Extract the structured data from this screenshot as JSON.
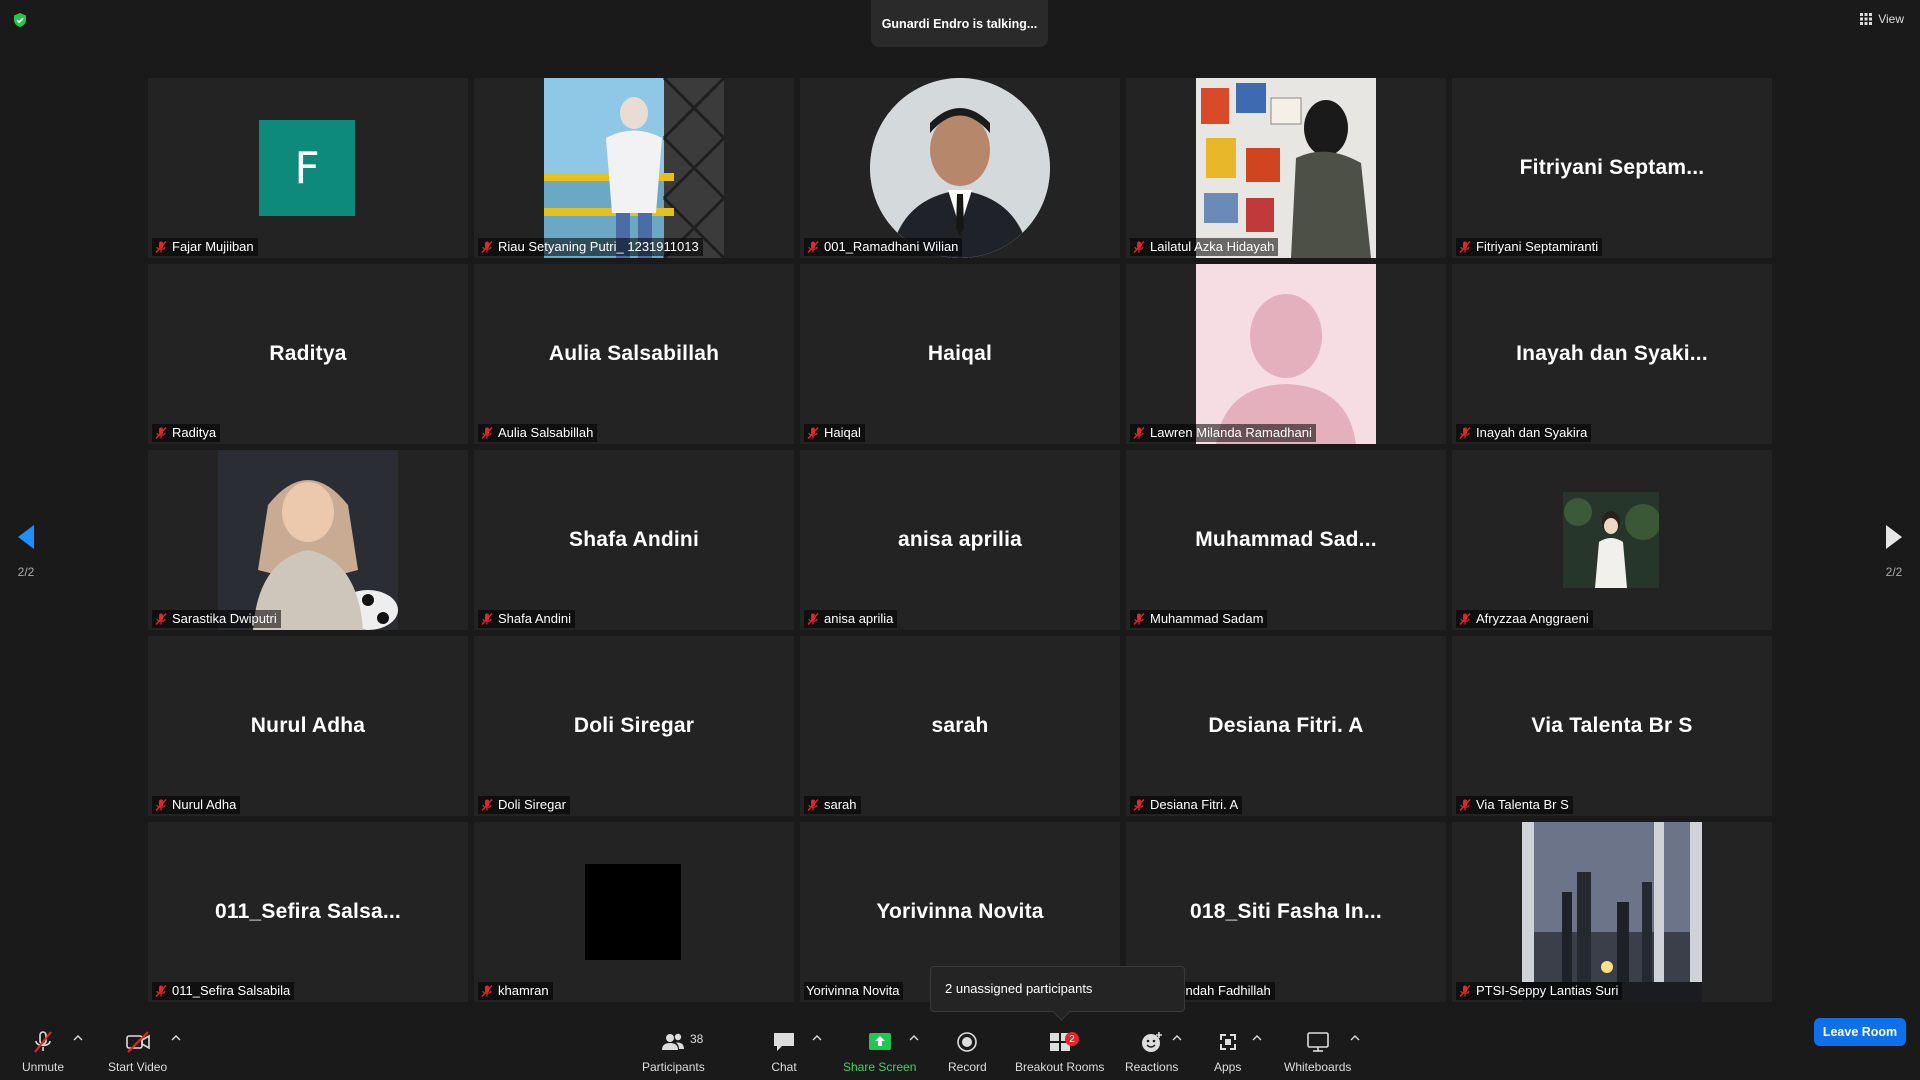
{
  "topbar": {
    "talking_indicator": "Gunardi Endro is talking...",
    "view_label": "View"
  },
  "pagination": {
    "left_label": "2/2",
    "right_label": "2/2"
  },
  "tiles": [
    {
      "label": "Fajar Mujiiban",
      "avatar_letter": "F",
      "kind": "avatar"
    },
    {
      "label": "Riau Setyaning Putri_ 1231911013",
      "kind": "photo"
    },
    {
      "label": "001_Ramadhani Wilian",
      "kind": "photo-round"
    },
    {
      "label": "Lailatul Azka Hidayah",
      "kind": "photo"
    },
    {
      "label": "Fitriyani Septamiranti",
      "display_name": "Fitriyani  Septam...",
      "kind": "name"
    },
    {
      "label": "Raditya",
      "display_name": "Raditya",
      "kind": "name"
    },
    {
      "label": "Aulia Salsabillah",
      "display_name": "Aulia Salsabillah",
      "kind": "name"
    },
    {
      "label": "Haiqal",
      "display_name": "Haiqal",
      "kind": "name"
    },
    {
      "label": "Lawren Milanda Ramadhani",
      "kind": "photo"
    },
    {
      "label": "Inayah dan Syakira",
      "display_name": "Inayah dan Syaki...",
      "kind": "name"
    },
    {
      "label": "Sarastika Dwiputri",
      "kind": "photo"
    },
    {
      "label": "Shafa Andini",
      "display_name": "Shafa Andini",
      "kind": "name"
    },
    {
      "label": "anisa aprilia",
      "display_name": "anisa aprilia",
      "kind": "name"
    },
    {
      "label": "Muhammad Sadam",
      "display_name": "Muhammad  Sad...",
      "kind": "name"
    },
    {
      "label": "Afryzzaa Anggraeni",
      "kind": "photo-sm"
    },
    {
      "label": "Nurul Adha",
      "display_name": "Nurul Adha",
      "kind": "name"
    },
    {
      "label": "Doli Siregar",
      "display_name": "Doli Siregar",
      "kind": "name"
    },
    {
      "label": "sarah",
      "display_name": "sarah",
      "kind": "name"
    },
    {
      "label": "Desiana Fitri. A",
      "display_name": "Desiana Fitri. A",
      "kind": "name"
    },
    {
      "label": "Via Talenta Br S",
      "display_name": "Via Talenta Br S",
      "kind": "name"
    },
    {
      "label": "011_Sefira Salsabila",
      "display_name": "011_Sefira  Salsa...",
      "kind": "name"
    },
    {
      "label": "khamran",
      "kind": "photo-sm"
    },
    {
      "label": "Yorivinna Novita",
      "display_name": "Yorivinna Novita",
      "kind": "name"
    },
    {
      "label": "ti Fasha Indah Fadhillah",
      "display_name": "018_Siti  Fasha  In...",
      "kind": "name"
    },
    {
      "label": "PTSI-Seppy Lantias Suri",
      "kind": "photo"
    }
  ],
  "popup": {
    "text": "2 unassigned participants"
  },
  "toolbar": {
    "unmute": "Unmute",
    "start_video": "Start Video",
    "participants": "Participants",
    "participants_count": "38",
    "chat": "Chat",
    "share_screen": "Share Screen",
    "record": "Record",
    "breakout_rooms": "Breakout Rooms",
    "breakout_badge": "2",
    "reactions": "Reactions",
    "apps": "Apps",
    "whiteboards": "Whiteboards",
    "leave_room": "Leave Room"
  },
  "colors": {
    "background": "#1a1a1a",
    "tile": "#232323",
    "avatar_teal": "#0e8a7b",
    "leave_blue": "#0e71eb",
    "share_green": "#3dd65b",
    "mute_red": "#e02828"
  }
}
